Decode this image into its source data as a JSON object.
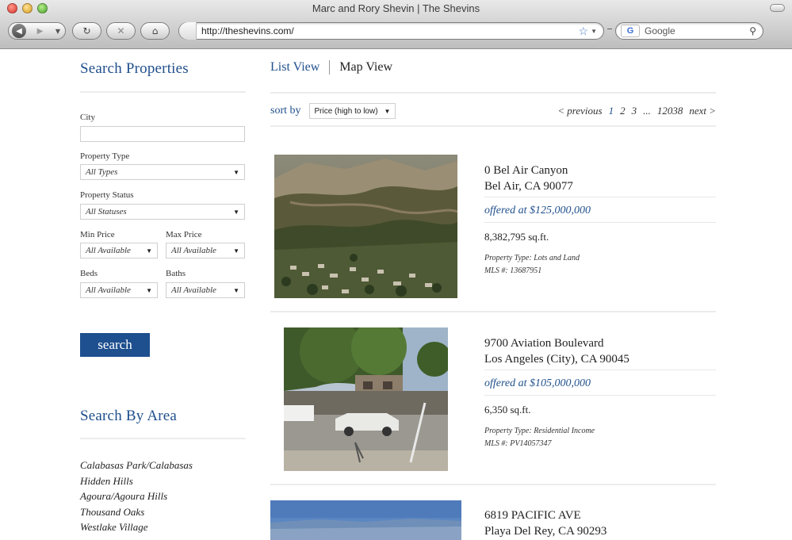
{
  "browser": {
    "window_title": "Marc and Rory Shevin | The Shevins",
    "url": "http://theshevins.com/",
    "search_placeholder": "Google",
    "google_badge": "G"
  },
  "sidebar": {
    "title": "Search Properties",
    "city_label": "City",
    "city_value": "",
    "property_type_label": "Property Type",
    "property_type_value": "All Types",
    "property_status_label": "Property Status",
    "property_status_value": "All Statuses",
    "min_price_label": "Min Price",
    "min_price_value": "All Available",
    "max_price_label": "Max Price",
    "max_price_value": "All Available",
    "beds_label": "Beds",
    "beds_value": "All Available",
    "baths_label": "Baths",
    "baths_value": "All Available",
    "search_button": "search",
    "area_title": "Search By Area",
    "areas": [
      "Calabasas Park/Calabasas",
      "Hidden Hills",
      "Agoura/Agoura Hills",
      "Thousand Oaks",
      "Westlake Village"
    ]
  },
  "main": {
    "tabs": {
      "list": "List View",
      "map": "Map View"
    },
    "sort_label": "sort by",
    "sort_value": "Price (high to low)",
    "pager": {
      "previous": "< previous",
      "p1": "1",
      "p2": "2",
      "p3": "3",
      "ellipsis": "...",
      "last": "12038",
      "next": "next >"
    },
    "listings": [
      {
        "address1": "0 Bel Air Canyon",
        "address2": "Bel Air, CA 90077",
        "price": "offered at $125,000,000",
        "sqft": "8,382,795 sq.ft.",
        "type": "Property Type: Lots and Land",
        "mls": "MLS #: 13687951"
      },
      {
        "address1": "9700 Aviation Boulevard",
        "address2": "Los Angeles (City), CA 90045",
        "price": "offered at $105,000,000",
        "sqft": "6,350 sq.ft.",
        "type": "Property Type: Residential Income",
        "mls": "MLS #: PV14057347"
      },
      {
        "address1": "6819 PACIFIC AVE",
        "address2": "Playa Del Rey, CA 90293"
      }
    ]
  }
}
